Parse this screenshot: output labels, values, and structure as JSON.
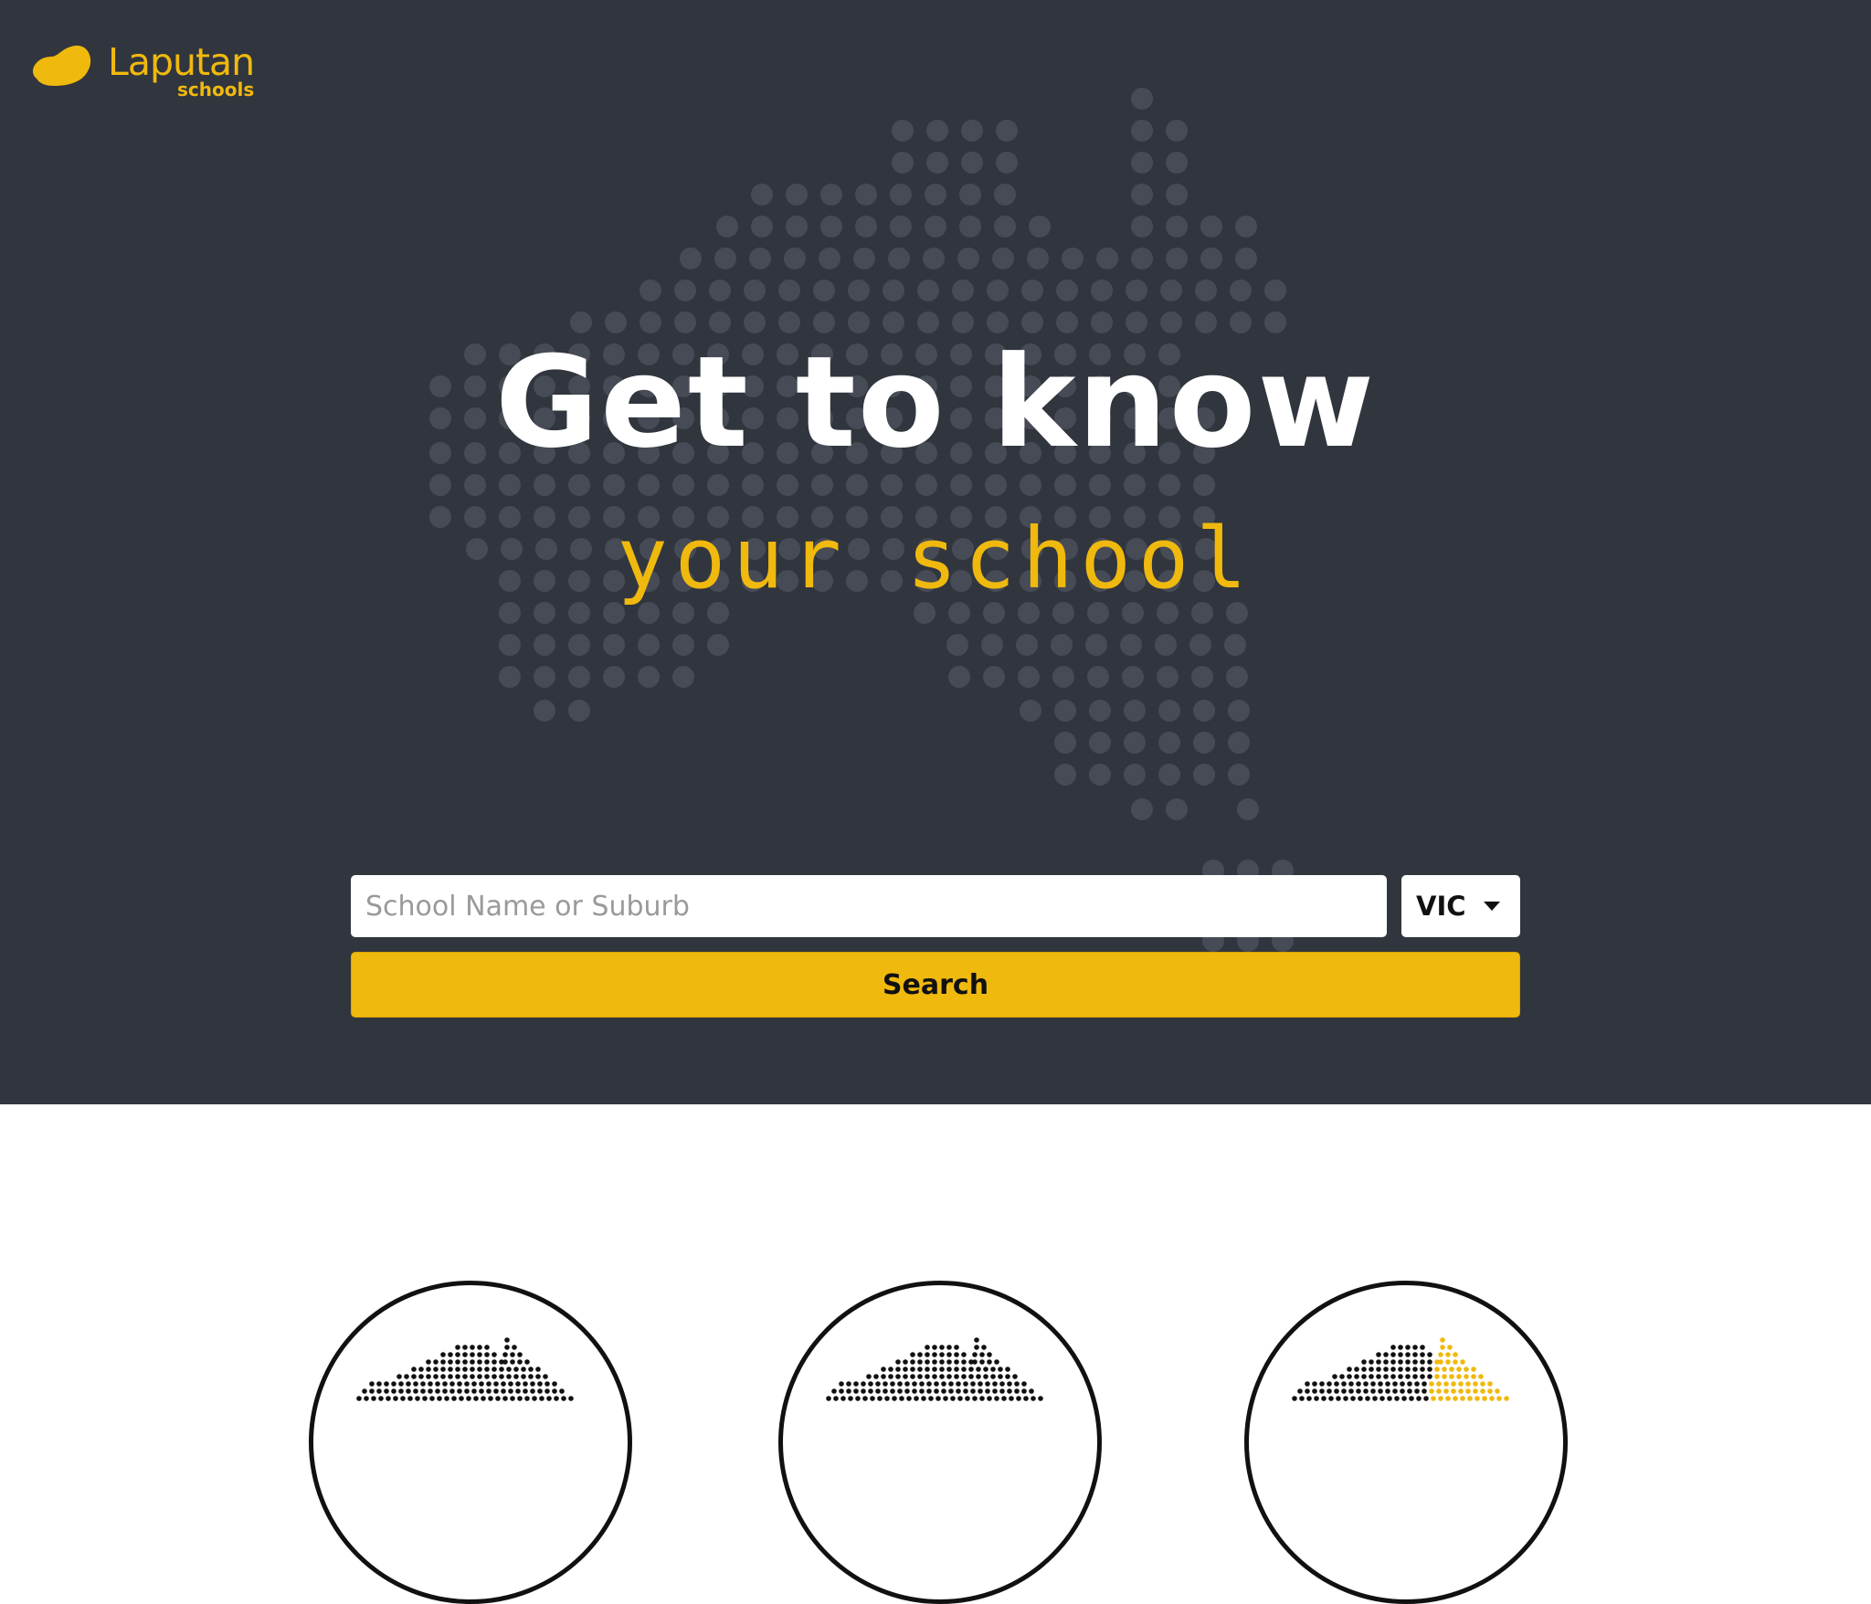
{
  "brand": {
    "name": "Laputan",
    "tagline": "schools",
    "accent_color": "#f0b90e",
    "hero_bg_color": "#31353e"
  },
  "hero": {
    "headline": "Get to know",
    "subheadline": "your school",
    "background_icon": "australia-dot-map"
  },
  "search": {
    "placeholder": "School Name or Suburb",
    "value": "",
    "state_selected": "VIC",
    "button_label": "Search"
  },
  "features": [
    {
      "icon": "australia-map-icon",
      "highlight": "none"
    },
    {
      "icon": "australia-map-icon",
      "highlight": "none"
    },
    {
      "icon": "australia-map-icon",
      "highlight": "queensland"
    }
  ]
}
